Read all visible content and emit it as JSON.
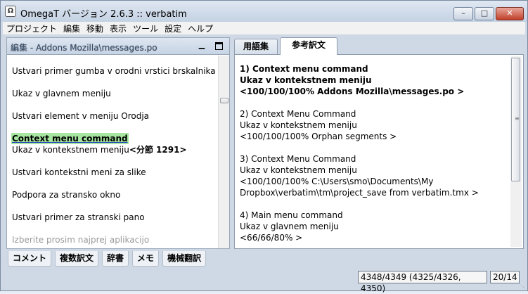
{
  "window": {
    "title": "OmegaT バージョン 2.6.3 :: verbatim",
    "app_icon": "Ω"
  },
  "menu": [
    "プロジェクト",
    "編集",
    "移動",
    "表示",
    "ツール",
    "設定",
    "ヘルプ"
  ],
  "editor": {
    "title": "編集 - Addons Mozilla\\messages.po",
    "segments_before": [
      "Ustvari primer gumba v orodni vrstici brskalnika",
      "Ukaz v glavnem meniju",
      "Ustvari element v meniju Orodja"
    ],
    "active_source": "Context menu command",
    "active_target": "Ukaz v kontekstnem meniju",
    "active_tag": "<分節 1291>",
    "segments_after": [
      "Ustvari kontekstni meni za slike",
      "Podpora za stransko okno",
      "Ustvari primer za stranski pano"
    ],
    "segment_faded": "Izberite prosim najprej aplikacijo"
  },
  "right_tabs": {
    "glossary": "用語集",
    "compare": "参考訳文"
  },
  "matches": [
    {
      "lines": [
        "1) Context menu command",
        "Ukaz v kontekstnem meniju",
        "<100/100/100% Addons Mozilla\\messages.po >"
      ]
    },
    {
      "lines": [
        "2) Context Menu Command",
        "Ukaz v kontekstnem meniju",
        "<100/100/100% Orphan segments >"
      ]
    },
    {
      "lines": [
        "3) Context Menu Command",
        "Ukaz v kontekstnem meniju",
        "<100/100/100% C:\\Users\\smo\\Documents\\My",
        "Dropbox\\verbatim\\tm\\project_save from verbatim.tmx >"
      ]
    },
    {
      "lines": [
        "4) Main menu command",
        "Ukaz v glavnem meniju",
        "<66/66/80%  >"
      ]
    }
  ],
  "bottom_tabs": [
    "コメント",
    "複数訳文",
    "辞書",
    "メモ",
    "機械翻訳"
  ],
  "status": {
    "progress": "4348/4349 (4325/4326, 4350)",
    "count": "20/14"
  }
}
